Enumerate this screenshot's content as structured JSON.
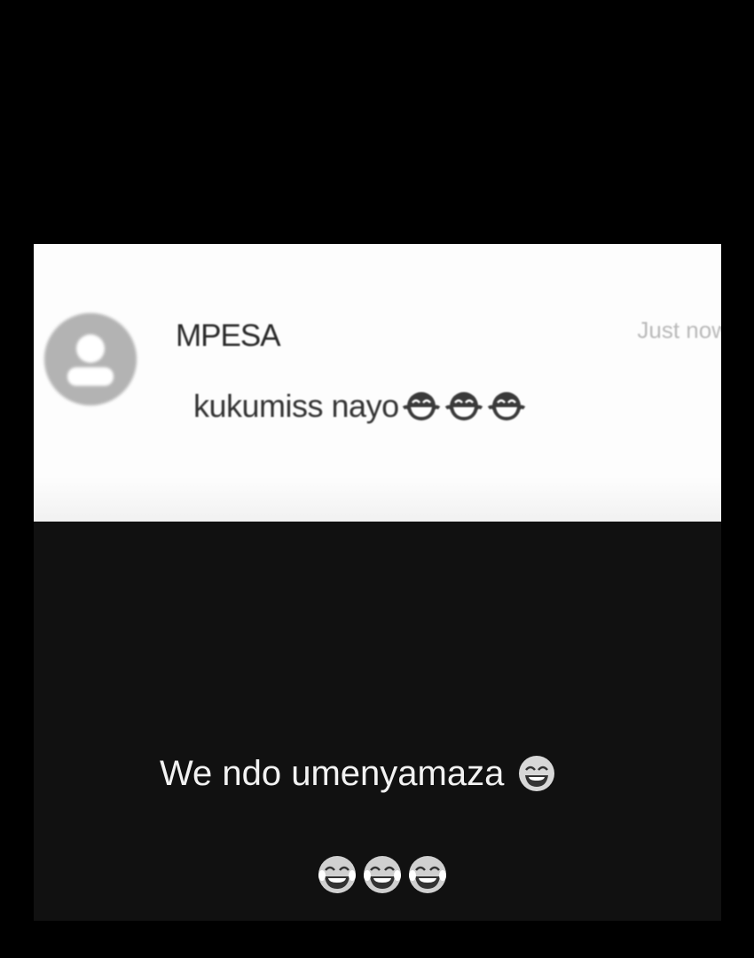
{
  "notification": {
    "sender": "MPESA",
    "time": "Just now",
    "message": "kukumiss nayo",
    "message_emojis": [
      "laughing-face-icon",
      "laughing-face-icon",
      "laughing-face-icon"
    ],
    "avatar_icon": "person-icon"
  },
  "caption": {
    "text": "We ndo umenyamaza",
    "emoji": "laughing-face-icon"
  },
  "reactions": [
    "tears-of-joy-icon",
    "tears-of-joy-icon",
    "tears-of-joy-icon"
  ],
  "colors": {
    "background": "#000000",
    "card": "#fdfdfd",
    "panel": "#111111",
    "caption_text": "#f2f2f2"
  }
}
